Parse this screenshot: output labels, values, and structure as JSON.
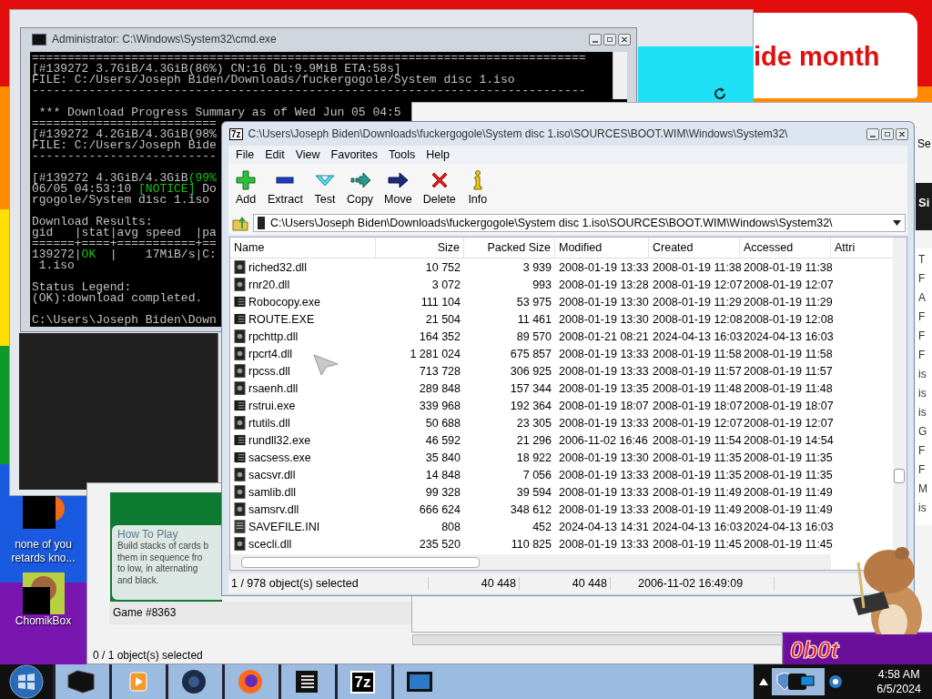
{
  "banner": {
    "text": "ide month"
  },
  "desktop_icons": [
    {
      "label": "none of you retards kno...",
      "kind": "media"
    },
    {
      "label": "ChomikBox",
      "kind": "chomik"
    }
  ],
  "side_window": {
    "title": "Se",
    "header": "Si",
    "items": [
      "T",
      "F",
      "A",
      "F",
      "F",
      "F",
      "is",
      "is",
      "is",
      "G",
      "F",
      "F",
      "M",
      "is"
    ]
  },
  "game_window": {
    "heading": "How To Play",
    "text": "Build stacks of cards b\nthem in sequence fro\nto low, in alternating\nand black.",
    "game": "Game #8363",
    "status": "0 / 1 object(s) selected"
  },
  "console": {
    "title": "Administrator: C:\\Windows\\System32\\cmd.exe",
    "lines": [
      {
        "kind": "text",
        "segments": [
          {
            "text": "==============================================================================",
            "highlight": false
          }
        ]
      },
      {
        "kind": "text",
        "segments": [
          {
            "text": "[#139272 3.7GiB/4.3GiB(86%) CN:16 DL:9.9MiB ETA:58s]",
            "highlight": false
          }
        ]
      },
      {
        "kind": "text",
        "segments": [
          {
            "text": "FILE: C:/Users/Joseph Biden/Downloads/fuckergogole/System disc 1.iso",
            "highlight": false
          }
        ]
      },
      {
        "kind": "text",
        "segments": [
          {
            "text": "------------------------------------------------------------------------------",
            "highlight": false
          }
        ]
      },
      {
        "kind": "blank"
      },
      {
        "kind": "text",
        "segments": [
          {
            "text": " *** Download Progress Summary as of Wed Jun 05 04:5",
            "highlight": false
          }
        ]
      },
      {
        "kind": "text",
        "segments": [
          {
            "text": "==========================",
            "highlight": false
          }
        ]
      },
      {
        "kind": "text",
        "segments": [
          {
            "text": "[#139272 4.2GiB/4.3GiB(98%",
            "highlight": false
          }
        ]
      },
      {
        "kind": "text",
        "segments": [
          {
            "text": "FILE: C:/Users/Joseph Bide",
            "highlight": false
          }
        ]
      },
      {
        "kind": "text",
        "segments": [
          {
            "text": "--------------------------",
            "highlight": false
          }
        ]
      },
      {
        "kind": "blank"
      },
      {
        "kind": "text",
        "segments": [
          {
            "text": "[#139272 4.3GiB/4.3GiB",
            "highlight": false
          },
          {
            "text": "(99%",
            "highlight": true
          }
        ]
      },
      {
        "kind": "text",
        "segments": [
          {
            "text": "06/05 04:53:10 ",
            "highlight": false
          },
          {
            "text": "[NOTICE]",
            "highlight": true
          },
          {
            "text": " Do",
            "highlight": false
          }
        ]
      },
      {
        "kind": "text",
        "segments": [
          {
            "text": "rgogole/System disc 1.iso",
            "highlight": false
          }
        ]
      },
      {
        "kind": "blank"
      },
      {
        "kind": "text",
        "segments": [
          {
            "text": "Download Results:",
            "highlight": false
          }
        ]
      },
      {
        "kind": "text",
        "segments": [
          {
            "text": "gid   |stat|avg speed  |pa",
            "highlight": false
          }
        ]
      },
      {
        "kind": "text",
        "segments": [
          {
            "text": "======+====+===========+==",
            "highlight": false
          }
        ]
      },
      {
        "kind": "text",
        "segments": [
          {
            "text": "139272|",
            "highlight": false
          },
          {
            "text": "OK",
            "highlight": true
          },
          {
            "text": "  |    17MiB/s|C:",
            "highlight": false
          }
        ]
      },
      {
        "kind": "text",
        "segments": [
          {
            "text": " 1.iso",
            "highlight": false
          }
        ]
      },
      {
        "kind": "blank"
      },
      {
        "kind": "text",
        "segments": [
          {
            "text": "Status Legend:",
            "highlight": false
          }
        ]
      },
      {
        "kind": "text",
        "segments": [
          {
            "text": "(OK):download completed.",
            "highlight": false
          }
        ]
      },
      {
        "kind": "blank"
      },
      {
        "kind": "text",
        "segments": [
          {
            "text": "C:\\Users\\Joseph Biden\\Down",
            "highlight": false
          }
        ]
      }
    ]
  },
  "archive_window": {
    "logo": "7z",
    "title": "C:\\Users\\Joseph Biden\\Downloads\\fuckergogole\\System disc 1.iso\\SOURCES\\BOOT.WIM\\Windows\\System32\\",
    "menu": [
      "File",
      "Edit",
      "View",
      "Favorites",
      "Tools",
      "Help"
    ],
    "toolbar": [
      {
        "label": "Add",
        "kind": "add"
      },
      {
        "label": "Extract",
        "kind": "extract"
      },
      {
        "label": "Test",
        "kind": "test"
      },
      {
        "label": "Copy",
        "kind": "copy"
      },
      {
        "label": "Move",
        "kind": "move"
      },
      {
        "label": "Delete",
        "kind": "delete"
      },
      {
        "label": "Info",
        "kind": "info"
      }
    ],
    "address": "C:\\Users\\Joseph Biden\\Downloads\\fuckergogole\\System disc 1.iso\\SOURCES\\BOOT.WIM\\Windows\\System32\\",
    "columns": [
      "Name",
      "Size",
      "Packed Size",
      "Modified",
      "Created",
      "Accessed",
      "Attri"
    ],
    "rows": [
      {
        "kind": "dll",
        "cells": [
          "riched32.dll",
          "10 752",
          "3 939",
          "2008-01-19 13:33",
          "2008-01-19 11:38",
          "2008-01-19 11:38"
        ]
      },
      {
        "kind": "dll",
        "cells": [
          "rnr20.dll",
          "3 072",
          "993",
          "2008-01-19 13:28",
          "2008-01-19 12:07",
          "2008-01-19 12:07"
        ]
      },
      {
        "kind": "exe",
        "cells": [
          "Robocopy.exe",
          "111 104",
          "53 975",
          "2008-01-19 13:30",
          "2008-01-19 11:29",
          "2008-01-19 11:29"
        ]
      },
      {
        "kind": "exe",
        "cells": [
          "ROUTE.EXE",
          "21 504",
          "11 461",
          "2008-01-19 13:30",
          "2008-01-19 12:08",
          "2008-01-19 12:08"
        ]
      },
      {
        "kind": "dll",
        "cells": [
          "rpchttp.dll",
          "164 352",
          "89 570",
          "2008-01-21 08:21",
          "2024-04-13 16:03",
          "2024-04-13 16:03"
        ]
      },
      {
        "kind": "dll",
        "cells": [
          "rpcrt4.dll",
          "1 281 024",
          "675 857",
          "2008-01-19 13:33",
          "2008-01-19 11:58",
          "2008-01-19 11:58"
        ]
      },
      {
        "kind": "dll",
        "cells": [
          "rpcss.dll",
          "713 728",
          "306 925",
          "2008-01-19 13:33",
          "2008-01-19 11:57",
          "2008-01-19 11:57"
        ]
      },
      {
        "kind": "dll",
        "cells": [
          "rsaenh.dll",
          "289 848",
          "157 344",
          "2008-01-19 13:35",
          "2008-01-19 11:48",
          "2008-01-19 11:48"
        ]
      },
      {
        "kind": "exe",
        "cells": [
          "rstrui.exe",
          "339 968",
          "192 364",
          "2008-01-19 18:07",
          "2008-01-19 18:07",
          "2008-01-19 18:07"
        ]
      },
      {
        "kind": "dll",
        "cells": [
          "rtutils.dll",
          "50 688",
          "23 305",
          "2008-01-19 13:33",
          "2008-01-19 12:07",
          "2008-01-19 12:07"
        ]
      },
      {
        "kind": "exe",
        "cells": [
          "rundll32.exe",
          "46 592",
          "21 296",
          "2006-11-02 16:46",
          "2008-01-19 11:54",
          "2008-01-19 14:54"
        ]
      },
      {
        "kind": "exe",
        "cells": [
          "sacsess.exe",
          "35 840",
          "18 922",
          "2008-01-19 13:30",
          "2008-01-19 11:35",
          "2008-01-19 11:35"
        ]
      },
      {
        "kind": "dll",
        "cells": [
          "sacsvr.dll",
          "14 848",
          "7 056",
          "2008-01-19 13:33",
          "2008-01-19 11:35",
          "2008-01-19 11:35"
        ]
      },
      {
        "kind": "dll",
        "cells": [
          "samlib.dll",
          "99 328",
          "39 594",
          "2008-01-19 13:33",
          "2008-01-19 11:49",
          "2008-01-19 11:49"
        ]
      },
      {
        "kind": "dll",
        "cells": [
          "samsrv.dll",
          "666 624",
          "348 612",
          "2008-01-19 13:33",
          "2008-01-19 11:49",
          "2008-01-19 11:49"
        ]
      },
      {
        "kind": "ini",
        "cells": [
          "SAVEFILE.INI",
          "808",
          "452",
          "2024-04-13 14:31",
          "2024-04-13 16:03",
          "2024-04-13 16:03"
        ]
      },
      {
        "kind": "dll",
        "cells": [
          "scecli.dll",
          "235 520",
          "110 825",
          "2008-01-19 13:33",
          "2008-01-19 11:45",
          "2008-01-19 11:45"
        ]
      }
    ],
    "status": [
      "1 / 978 object(s) selected",
      "40 448",
      "40 448",
      "2006-11-02 16:49:09"
    ]
  },
  "promo": {
    "text": "0b0t"
  },
  "taskbar": {
    "items": [
      {
        "kind": "device"
      },
      {
        "kind": "media"
      },
      {
        "kind": "globe"
      },
      {
        "kind": "firefox"
      },
      {
        "kind": "list"
      },
      {
        "kind": "sevenzip",
        "label": "7z"
      },
      {
        "kind": "monitor"
      }
    ],
    "time": "4:58 AM",
    "date": "6/5/2024"
  }
}
